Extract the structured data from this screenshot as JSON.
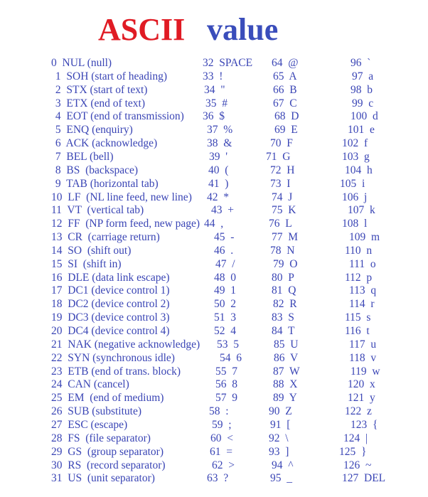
{
  "title": {
    "part1": "ASCII",
    "part2": "value",
    "part1_color": "#e01b24",
    "part2_color": "#3a4dbb"
  },
  "text_color": "#3a45b5",
  "columns": [
    [
      "0  NUL (null)",
      " 1  SOH (start of heading)",
      " 2  STX (start of text)",
      " 3  ETX (end of text)",
      " 4  EOT (end of transmission)",
      " 5  ENQ (enquiry)",
      " 6  ACK (acknowledge)",
      " 7  BEL (bell)",
      " 8  BS  (backspace)",
      " 9  TAB (horizontal tab)",
      "10  LF  (NL line feed, new line)",
      "11  VT  (vertical tab)",
      "12  FF  (NP form feed, new page)",
      "13  CR  (carriage return)",
      "14  SO  (shift out)",
      "15  SI  (shift in)",
      "16  DLE (data link escape)",
      "17  DC1 (device control 1)",
      "18  DC2 (device control 2)",
      "19  DC3 (device control 3)",
      "20  DC4 (device control 4)",
      "21  NAK (negative acknowledge)",
      "22  SYN (synchronous idle)",
      "23  ETB (end of trans. block)",
      "24  CAN (cancel)",
      "25  EM  (end of medium)",
      "26  SUB (substitute)",
      "27  ESC (escape)",
      "28  FS  (file separator)",
      "29  GS  (group separator)",
      "30  RS  (record separator)",
      "31  US  (unit separator)"
    ],
    [
      "32  SPACE",
      "33  !",
      "34  \"",
      "35  #",
      "36  $",
      "37  %",
      "38  &",
      "39  '",
      "40  (",
      "41  )",
      "42  *",
      "43  +",
      "44  ,",
      "45  -",
      "46  .",
      "47  /",
      "48  0",
      "49  1",
      "50  2",
      "51  3",
      "52  4",
      "53  5",
      "54  6",
      "55  7",
      "56  8",
      "57  9",
      "58  :",
      "59  ;",
      "60  <",
      "61  =",
      "62  >",
      "63  ?"
    ],
    [
      "64  @",
      "65  A",
      "66  B",
      "67  C",
      "68  D",
      "69  E",
      "70  F",
      "71  G",
      "72  H",
      "73  I",
      "74  J",
      "75  K",
      "76  L",
      "77  M",
      "78  N",
      "79  O",
      "80  P",
      "81  Q",
      "82  R",
      "83  S",
      "84  T",
      "85  U",
      "86  V",
      "87  W",
      "88  X",
      "89  Y",
      "90  Z",
      "91  [",
      "92  \\",
      "93  ]",
      "94  ^",
      "95  _"
    ],
    [
      "96  `",
      "97  a",
      "98  b",
      "99  c",
      "100  d",
      "101  e",
      "102  f",
      "103  g",
      "104  h",
      "105  i",
      "106  j",
      "107  k",
      "108  l",
      "109  m",
      "110  n",
      "111  o",
      "112  p",
      "113  q",
      "114  r",
      "115  s",
      "116  t",
      "117  u",
      "118  v",
      "119  w",
      "120  x",
      "121  y",
      "122  z",
      "123  {",
      "124  |",
      "125  }",
      "126  ~",
      "127  DEL"
    ]
  ]
}
